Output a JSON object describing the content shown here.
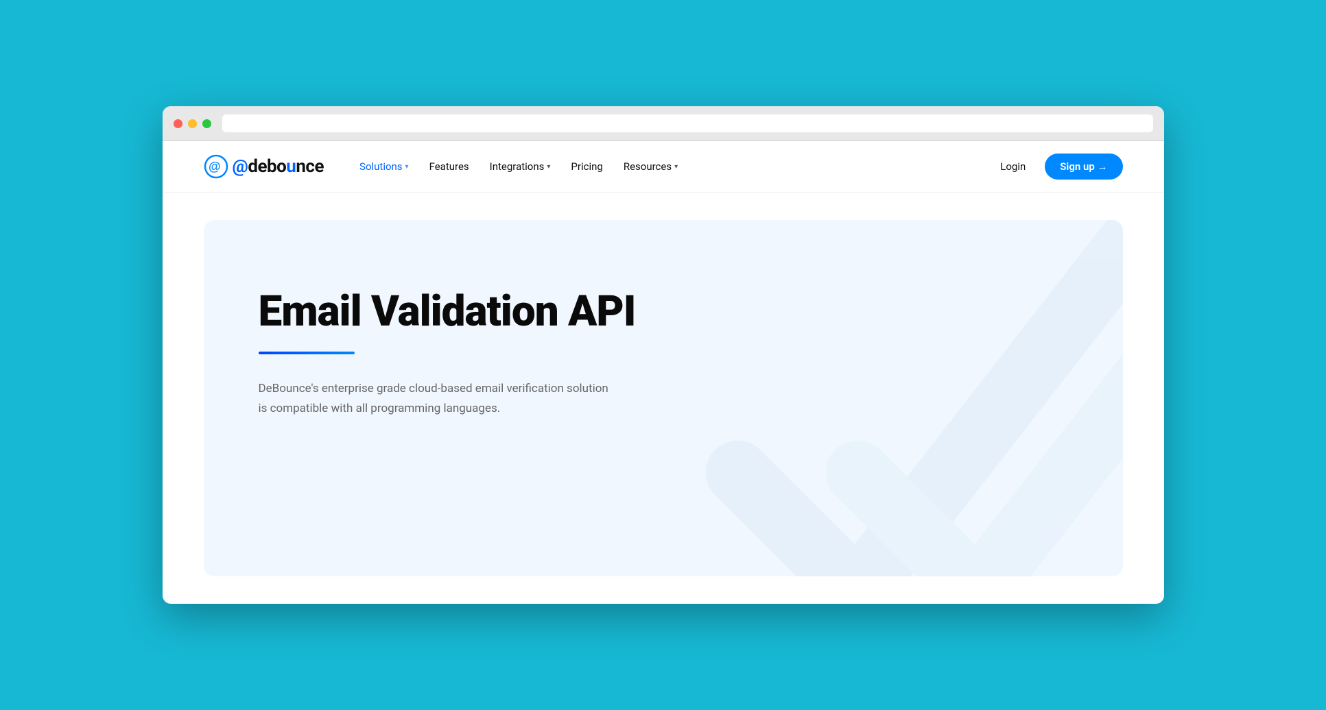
{
  "browser": {
    "traffic_lights": [
      "red",
      "yellow",
      "green"
    ]
  },
  "navbar": {
    "logo_text": "debounce",
    "nav_items": [
      {
        "label": "Solutions",
        "has_dropdown": true,
        "active": true
      },
      {
        "label": "Features",
        "has_dropdown": false,
        "active": false
      },
      {
        "label": "Integrations",
        "has_dropdown": true,
        "active": false
      },
      {
        "label": "Pricing",
        "has_dropdown": false,
        "active": false
      },
      {
        "label": "Resources",
        "has_dropdown": true,
        "active": false
      }
    ],
    "login_label": "Login",
    "signup_label": "Sign up →"
  },
  "hero": {
    "title": "Email Validation API",
    "description": "DeBounce's enterprise grade cloud-based email verification solution is compatible with all programming languages."
  }
}
